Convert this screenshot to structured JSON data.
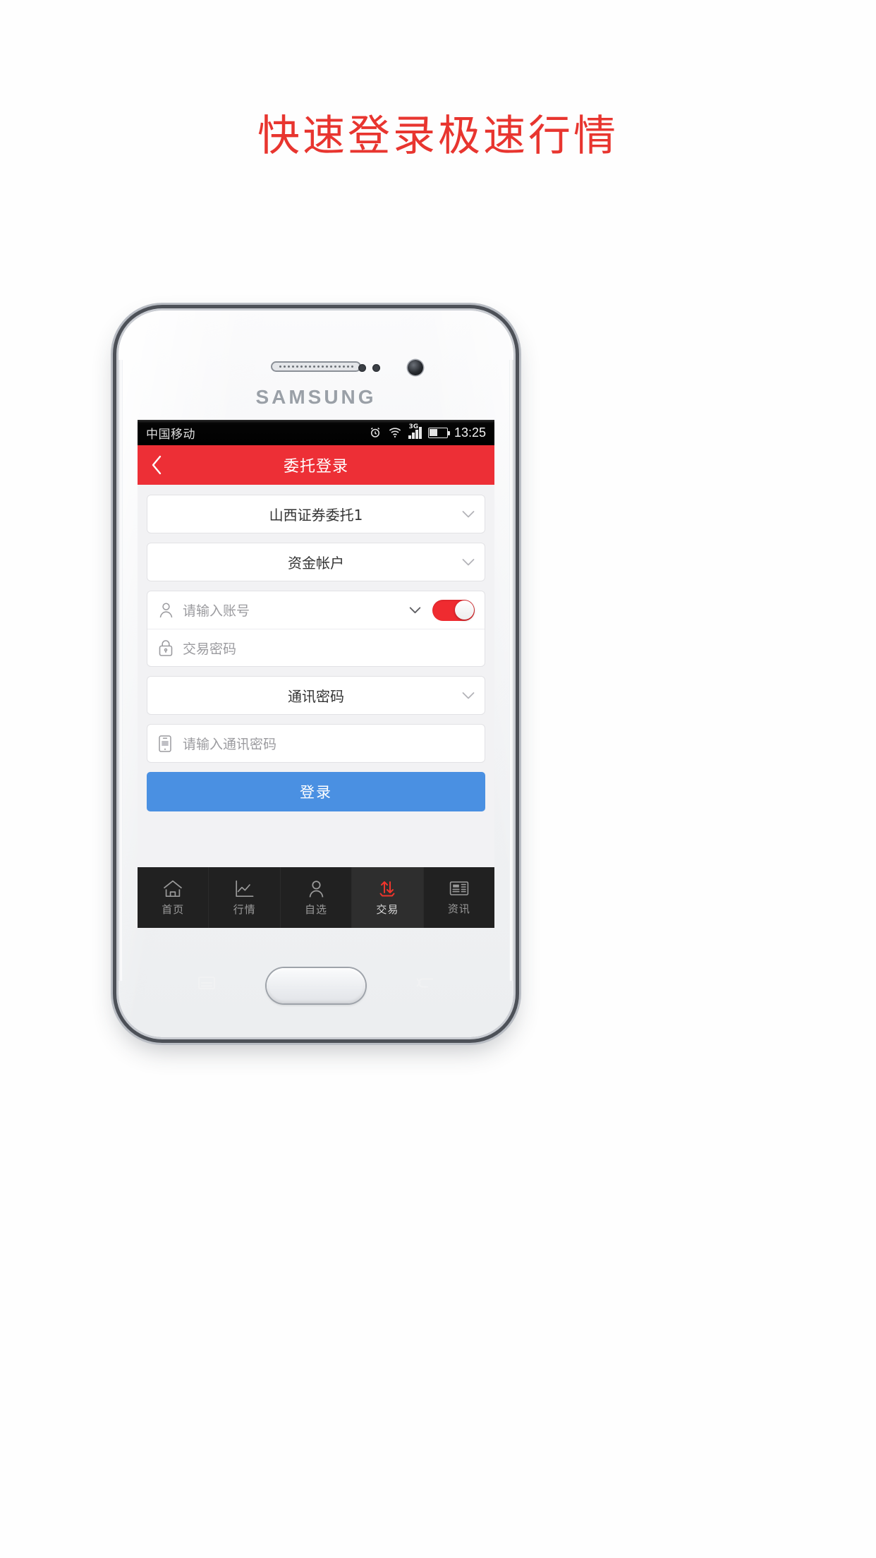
{
  "promo": {
    "headline": "快速登录极速行情",
    "accent_color": "#e8352f"
  },
  "device": {
    "brand": "SAMSUNG"
  },
  "statusbar": {
    "carrier": "中国移动",
    "network": "3G",
    "time": "13:25",
    "icons": [
      "alarm-icon",
      "wifi-icon",
      "signal-3g-icon",
      "battery-icon"
    ]
  },
  "header": {
    "title": "委托登录",
    "background_color": "#ed2f36",
    "back_icon": "chevron-left-icon"
  },
  "form": {
    "broker_select": {
      "value": "山西证券委托1",
      "icon": "chevron-down-icon"
    },
    "account_type_select": {
      "value": "资金帐户",
      "icon": "chevron-down-icon"
    },
    "account_input": {
      "placeholder": "请输入账号",
      "lead_icon": "user-icon",
      "dropdown_icon": "chevron-down-icon"
    },
    "remember_toggle": {
      "state": "on",
      "on_color": "#ef2b30"
    },
    "trade_password_input": {
      "placeholder": "交易密码",
      "lead_icon": "lock-icon"
    },
    "comm_password_select": {
      "value": "通讯密码",
      "icon": "chevron-down-icon"
    },
    "comm_password_input": {
      "placeholder": "请输入通讯密码",
      "lead_icon": "mobile-device-icon"
    },
    "login_button": {
      "label": "登录",
      "color": "#4a90e2"
    }
  },
  "tabbar": {
    "items": [
      {
        "label": "首页",
        "icon": "home-icon",
        "active": false
      },
      {
        "label": "行情",
        "icon": "line-chart-icon",
        "active": false
      },
      {
        "label": "自选",
        "icon": "user-icon",
        "active": false
      },
      {
        "label": "交易",
        "icon": "up-down-arrows-icon",
        "active": true
      },
      {
        "label": "资讯",
        "icon": "news-icon",
        "active": false
      }
    ],
    "active_color": "#f0352c"
  },
  "hardware": {
    "menu_key": "menu-key-icon",
    "home_key": "home-key",
    "back_key": "back-key-icon"
  }
}
